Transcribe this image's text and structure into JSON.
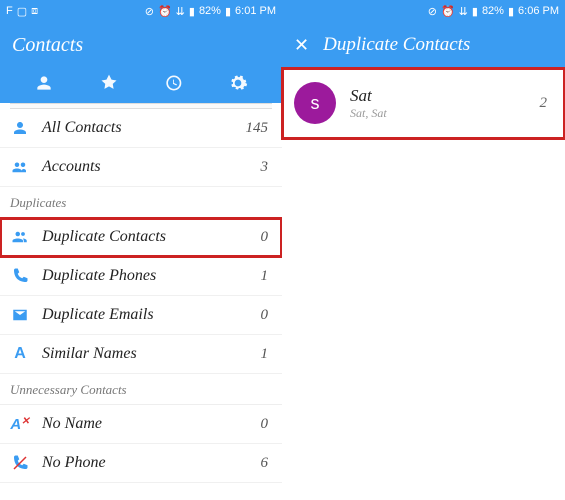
{
  "left": {
    "status": {
      "time": "6:01 PM",
      "battery": "82%"
    },
    "title": "Contacts",
    "accounts_stub": "Accounts",
    "items": [
      {
        "icon": "person",
        "label": "All Contacts",
        "count": "145"
      },
      {
        "icon": "accounts",
        "label": "Accounts",
        "count": "3"
      }
    ],
    "section_duplicates": "Duplicates",
    "dup_items": [
      {
        "icon": "group",
        "label": "Duplicate Contacts",
        "count": "0",
        "highlight": true
      },
      {
        "icon": "phone",
        "label": "Duplicate Phones",
        "count": "1"
      },
      {
        "icon": "email",
        "label": "Duplicate Emails",
        "count": "0"
      },
      {
        "icon": "letter",
        "label": "Similar Names",
        "count": "1"
      }
    ],
    "section_unnecessary": "Unnecessary Contacts",
    "unn_items": [
      {
        "icon": "noname",
        "label": "No Name",
        "count": "0"
      },
      {
        "icon": "nophone",
        "label": "No Phone",
        "count": "6"
      }
    ]
  },
  "right": {
    "status": {
      "time": "6:06 PM",
      "battery": "82%"
    },
    "title": "Duplicate Contacts",
    "contact": {
      "initial": "s",
      "name": "Sat",
      "sub": "Sat, Sat",
      "count": "2"
    }
  }
}
